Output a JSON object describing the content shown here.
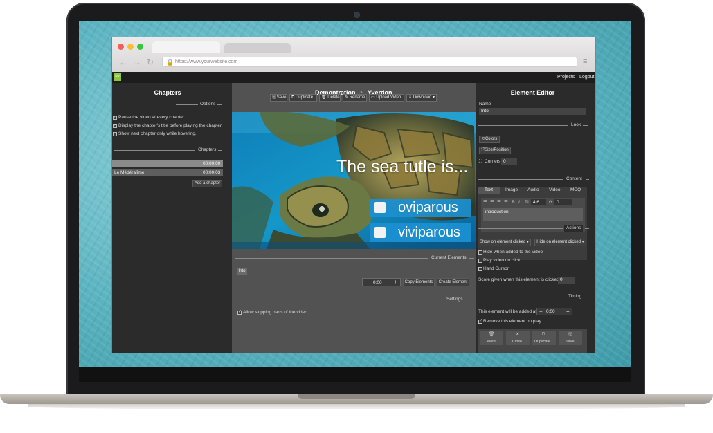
{
  "browser": {
    "url": "https://www.yourwebsite.com",
    "lock_icon": "lock-icon",
    "nav": [
      "back-icon",
      "forward-icon",
      "reload-icon"
    ],
    "menu_icon": "hamburger-icon"
  },
  "header": {
    "logo": "ev",
    "projects": "Projects",
    "logout": "Logout"
  },
  "left": {
    "title": "Chapters",
    "options_label": "Options",
    "options": [
      {
        "label": "Pause the video at every chapter.",
        "checked": true
      },
      {
        "label": "Display the chapter's title before playing the chapter.",
        "checked": true
      },
      {
        "label": "Show next chapter only while hovering.",
        "checked": false
      }
    ],
    "chapters_label": "Chapters",
    "chapters": [
      {
        "name": "",
        "time": "00:00:00"
      },
      {
        "name": "Le Médéralîme",
        "time": "00:00:03"
      }
    ],
    "add_chapter": "Add a chapter"
  },
  "middle": {
    "breadcrumb": [
      "Demontration",
      "Yverdon"
    ],
    "breadcrumb_sep": ">",
    "toolbar": [
      {
        "icon": "save-icon",
        "label": "Save"
      },
      {
        "icon": "duplicate-icon",
        "label": "Duplicate"
      },
      {
        "icon": "trash-icon",
        "label": "Delete"
      },
      {
        "icon": "pencil-icon",
        "label": "Rename"
      },
      {
        "icon": "video-icon",
        "label": "Upload Video"
      },
      {
        "icon": "download-icon",
        "label": "Download"
      }
    ],
    "video": {
      "question": "The sea tutle is...",
      "answers": [
        "oviparous",
        "viviparous"
      ]
    },
    "current_elements_label": "Current Elements",
    "element_chip": "Into",
    "time_value": "0:00",
    "minus": "−",
    "plus": "+",
    "copy_elements": "Copy Elements",
    "create_element": "Create Element",
    "settings_label": "Settings",
    "allow_skipping": "Allow skipping parts of the video."
  },
  "right": {
    "title": "Element Editor",
    "name_label": "Name",
    "name_value": "Into",
    "look_label": "Look",
    "colors": "Colors",
    "size_position": "Size/Position",
    "corners_label": "Corners",
    "corners_value": "0",
    "content_label": "Content",
    "tabs": [
      "Text",
      "Image",
      "Audio",
      "Video",
      "MCQ"
    ],
    "font_size": "4,6",
    "rotation": "0",
    "text_value": "introduction",
    "actions_label": "Actions",
    "show_on": "Show on element clicked",
    "hide_on": "Hide on element clicked",
    "action_checks": [
      "Hide when added to the video",
      "Play video on click",
      "Hand Cursor"
    ],
    "score_label": "Score given when this element is clicked",
    "score_value": "0",
    "timing_label": "Timing",
    "added_at_label": "This element will be added at",
    "added_at_value": "0:00",
    "remove_label": "Remove this element on play",
    "footer": [
      {
        "icon": "trash-icon",
        "label": "Delete"
      },
      {
        "icon": "close-icon",
        "label": "Close"
      },
      {
        "icon": "duplicate-icon",
        "label": "Duplicate"
      },
      {
        "icon": "save-icon",
        "label": "Save"
      }
    ]
  }
}
